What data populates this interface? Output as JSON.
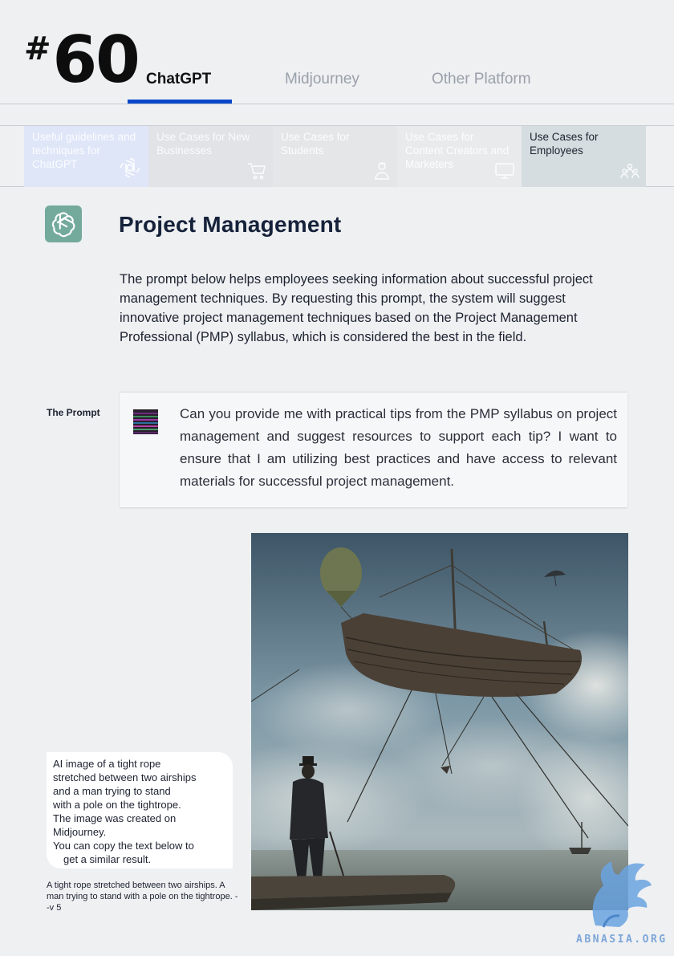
{
  "header": {
    "hash": "#",
    "page_number": "60",
    "tabs": [
      {
        "label": "ChatGPT",
        "active": true
      },
      {
        "label": "Midjourney",
        "active": false
      },
      {
        "label": "Other Platform",
        "active": false
      }
    ]
  },
  "categories": [
    {
      "label": "Useful guidelines and techniques for ChatGPT",
      "icon": "openai-icon"
    },
    {
      "label": "Use Cases for New Businesses",
      "icon": "cart-icon"
    },
    {
      "label": "Use Cases for Students",
      "icon": "student-icon"
    },
    {
      "label": "Use Cases for Content Creators and Marketers",
      "icon": "megaphone-icon"
    },
    {
      "label": "Use Cases for Employees",
      "icon": "team-icon",
      "active": true
    }
  ],
  "section": {
    "title": "Project Management",
    "description": "The prompt below helps employees seeking information about successful project management techniques. By requesting this prompt, the system will suggest innovative project management techniques based on the Project Management Professional (PMP) syllabus, which is considered the best in the field."
  },
  "prompt": {
    "label": "The Prompt",
    "text": "Can you provide me with practical tips from the PMP syllabus on project management and suggest resources to support each tip? I want to ensure that I am utilizing best practices and have access to relevant materials for successful project management."
  },
  "image_caption": {
    "lines": [
      "AI image of a tight rope",
      "stretched between two airships",
      "and a man trying to stand",
      "with a pole on the tightrope.",
      "The image was created on",
      "Midjourney.",
      "You can copy the text below to",
      "get a similar result."
    ],
    "midjourney_prompt": "A tight rope stretched between two airships. A man trying to stand with a pole on the tightrope. --v 5"
  },
  "watermark": {
    "text": "ABNASIA.ORG"
  },
  "colors": {
    "accent": "#0a47c9",
    "chatgpt_green": "#74aa9c",
    "title": "#16213a"
  }
}
